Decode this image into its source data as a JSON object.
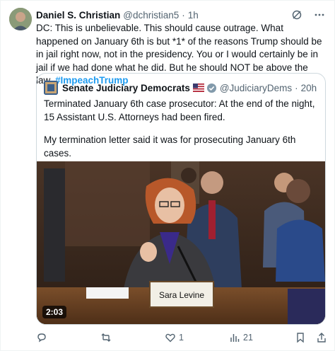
{
  "author": {
    "name": "Daniel S. Christian",
    "handle": "@dchristian5",
    "separator": "·",
    "time": "1h"
  },
  "tweet": {
    "text": "DC: This is unbelievable. This should cause outrage. What happened on January 6th is but *1* of the reasons Trump should be in jail right now, not in the presidency.  You or I would certainly be in jail if we had done what he did. But he should NOT be above the law. ",
    "hashtag": "#ImpeachTrump"
  },
  "quoted": {
    "name": "Senate Judiciary Democrats",
    "handle": "@JudiciaryDems",
    "separator": "·",
    "time": "20h",
    "paragraph1": "Terminated January 6th case prosecutor: At the end of the night, 15 Assistant U.S. Attorneys had been fired.",
    "paragraph2": "My termination letter said it was for prosecuting January 6th cases.",
    "ellipsis": "...",
    "video": {
      "nameplate": "Sara Levine",
      "duration": "2:03"
    }
  },
  "actions": {
    "replies": "",
    "retweets": "",
    "likes": "1",
    "views": "21"
  },
  "colors": {
    "accent": "#1d9bf0",
    "muted": "#536471",
    "border": "#cfd9de"
  },
  "icons": [
    "grok-icon",
    "more-icon",
    "flag-us-icon",
    "verified-gray-icon",
    "reply-icon",
    "retweet-icon",
    "like-icon",
    "views-icon",
    "bookmark-icon",
    "share-icon"
  ]
}
